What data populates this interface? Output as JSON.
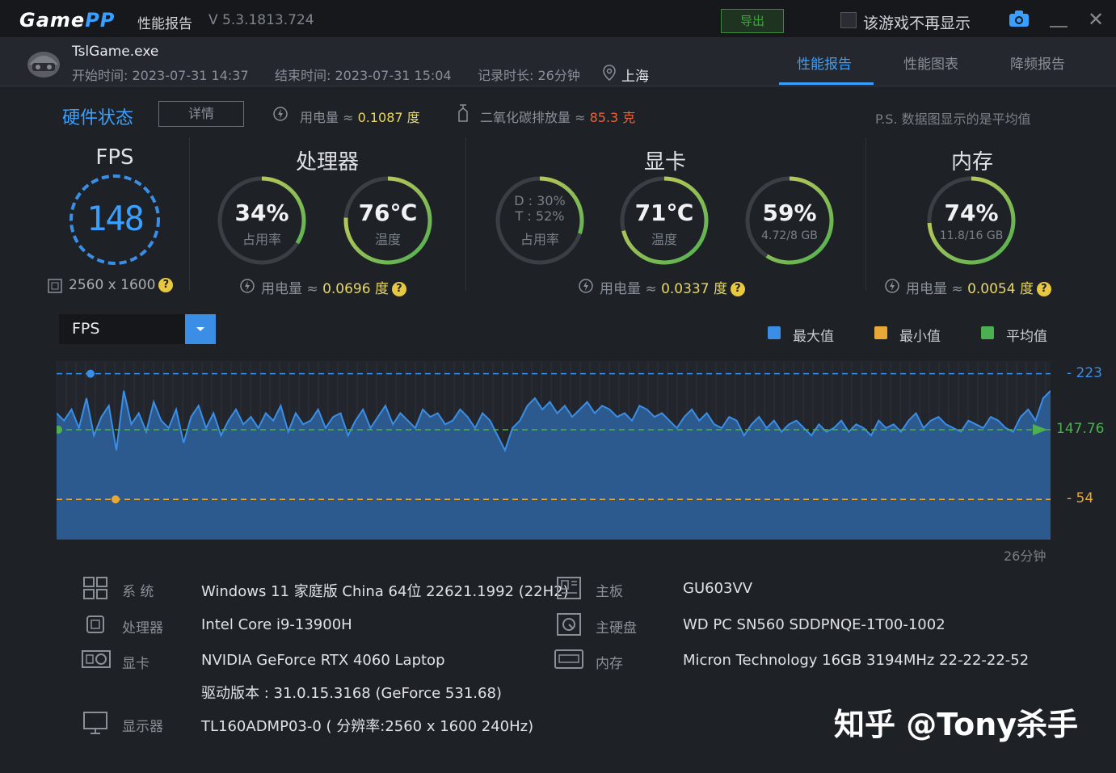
{
  "titlebar": {
    "logo_game": "Game",
    "logo_pp": "PP",
    "title": "性能报告",
    "version": "V 5.3.1813.724",
    "export_label": "导出",
    "hide_game_label": "该游戏不再显示"
  },
  "session": {
    "exe": "TslGame.exe",
    "start": "开始时间: 2023-07-31 14:37",
    "end": "结束时间: 2023-07-31 15:04",
    "duration": "记录时长: 26分钟",
    "location": "上海"
  },
  "tabs": [
    {
      "label": "性能报告",
      "active": true
    },
    {
      "label": "性能图表",
      "active": false
    },
    {
      "label": "降频报告",
      "active": false
    }
  ],
  "hardware": {
    "title": "硬件状态",
    "detail_button": "详情",
    "power_label": "用电量 ≈ ",
    "power_value": "0.1087 度",
    "co2_label": "二氧化碳排放量 ≈ ",
    "co2_value": "85.3 克",
    "ps_note": "P.S. 数据图显示的是平均值"
  },
  "fps_section": {
    "title": "FPS",
    "value": "148",
    "resolution": "2560 x 1600",
    "gauge_fraction": 1.0
  },
  "cpu_section": {
    "title": "处理器",
    "usage_value": "34%",
    "usage_label": "占用率",
    "usage_fraction": 0.34,
    "temp_value": "76℃",
    "temp_label": "温度",
    "temp_fraction": 0.76,
    "power_label": "用电量 ≈ ",
    "power_value": "0.0696 度"
  },
  "gpu_section": {
    "title": "显卡",
    "usage_d": "D : 30%",
    "usage_t": "T : 52%",
    "usage_label": "占用率",
    "usage_fraction": 0.3,
    "temp_value": "71℃",
    "temp_label": "温度",
    "temp_fraction": 0.71,
    "mem_value": "59%",
    "mem_label": "4.72/8 GB",
    "mem_fraction": 0.59,
    "power_label": "用电量 ≈ ",
    "power_value": "0.0337 度"
  },
  "mem_section": {
    "title": "内存",
    "usage_value": "74%",
    "usage_label": "11.8/16 GB",
    "usage_fraction": 0.74,
    "power_label": "用电量 ≈ ",
    "power_value": "0.0054 度"
  },
  "chart_controls": {
    "metric_selected": "FPS",
    "legend": [
      {
        "label": "最大值",
        "color": "#3a8ee6"
      },
      {
        "label": "最小值",
        "color": "#e8a838"
      },
      {
        "label": "平均值",
        "color": "#4caf50"
      }
    ],
    "duration_label": "26分钟"
  },
  "chart_data": {
    "type": "area",
    "title": "",
    "xlabel": "",
    "ylabel": "",
    "x_end_label": "26分钟",
    "max": 223,
    "avg": 147.76,
    "min": 54,
    "ylim": [
      0,
      240
    ],
    "series": [
      {
        "name": "FPS",
        "values": [
          170,
          160,
          175,
          150,
          190,
          140,
          165,
          180,
          120,
          200,
          155,
          170,
          145,
          185,
          160,
          150,
          175,
          130,
          165,
          180,
          150,
          170,
          140,
          160,
          175,
          155,
          165,
          150,
          170,
          160,
          180,
          145,
          170,
          155,
          160,
          175,
          150,
          165,
          170,
          140,
          160,
          175,
          150,
          165,
          180,
          155,
          170,
          160,
          150,
          175,
          165,
          170,
          155,
          160,
          175,
          165,
          150,
          170,
          160,
          140,
          120,
          150,
          160,
          180,
          190,
          175,
          185,
          170,
          180,
          165,
          175,
          185,
          170,
          180,
          175,
          165,
          170,
          160,
          180,
          175,
          165,
          170,
          160,
          150,
          165,
          175,
          160,
          170,
          155,
          150,
          165,
          160,
          140,
          155,
          165,
          150,
          160,
          145,
          155,
          160,
          150,
          140,
          155,
          145,
          150,
          160,
          145,
          155,
          150,
          140,
          160,
          150,
          155,
          145,
          160,
          170,
          150,
          160,
          165,
          155,
          150,
          145,
          160,
          155,
          150,
          165,
          160,
          150,
          145,
          165,
          175,
          160,
          190,
          200
        ]
      }
    ]
  },
  "system": {
    "os_label": "系  统",
    "os_value": "Windows 11 家庭版 China 64位 22621.1992 (22H2)",
    "cpu_label": "处理器",
    "cpu_value": "Intel Core i9-13900H",
    "gpu_label": "显卡",
    "gpu_value": "NVIDIA GeForce RTX 4060 Laptop",
    "driver_value": "驱动版本 : 31.0.15.3168 (GeForce 531.68)",
    "monitor_label": "显示器",
    "monitor_value": "TL160ADMP03-0 ( 分辨率:2560 x 1600 240Hz)",
    "board_label": "主板",
    "board_value": "GU603VV",
    "disk_label": "主硬盘",
    "disk_value": "WD PC SN560 SDDPNQE-1T00-1002",
    "ram_label": "内存",
    "ram_value": "Micron Technology 16GB 3194MHz 22-22-22-52"
  },
  "watermark": "知乎 @Tony杀手"
}
